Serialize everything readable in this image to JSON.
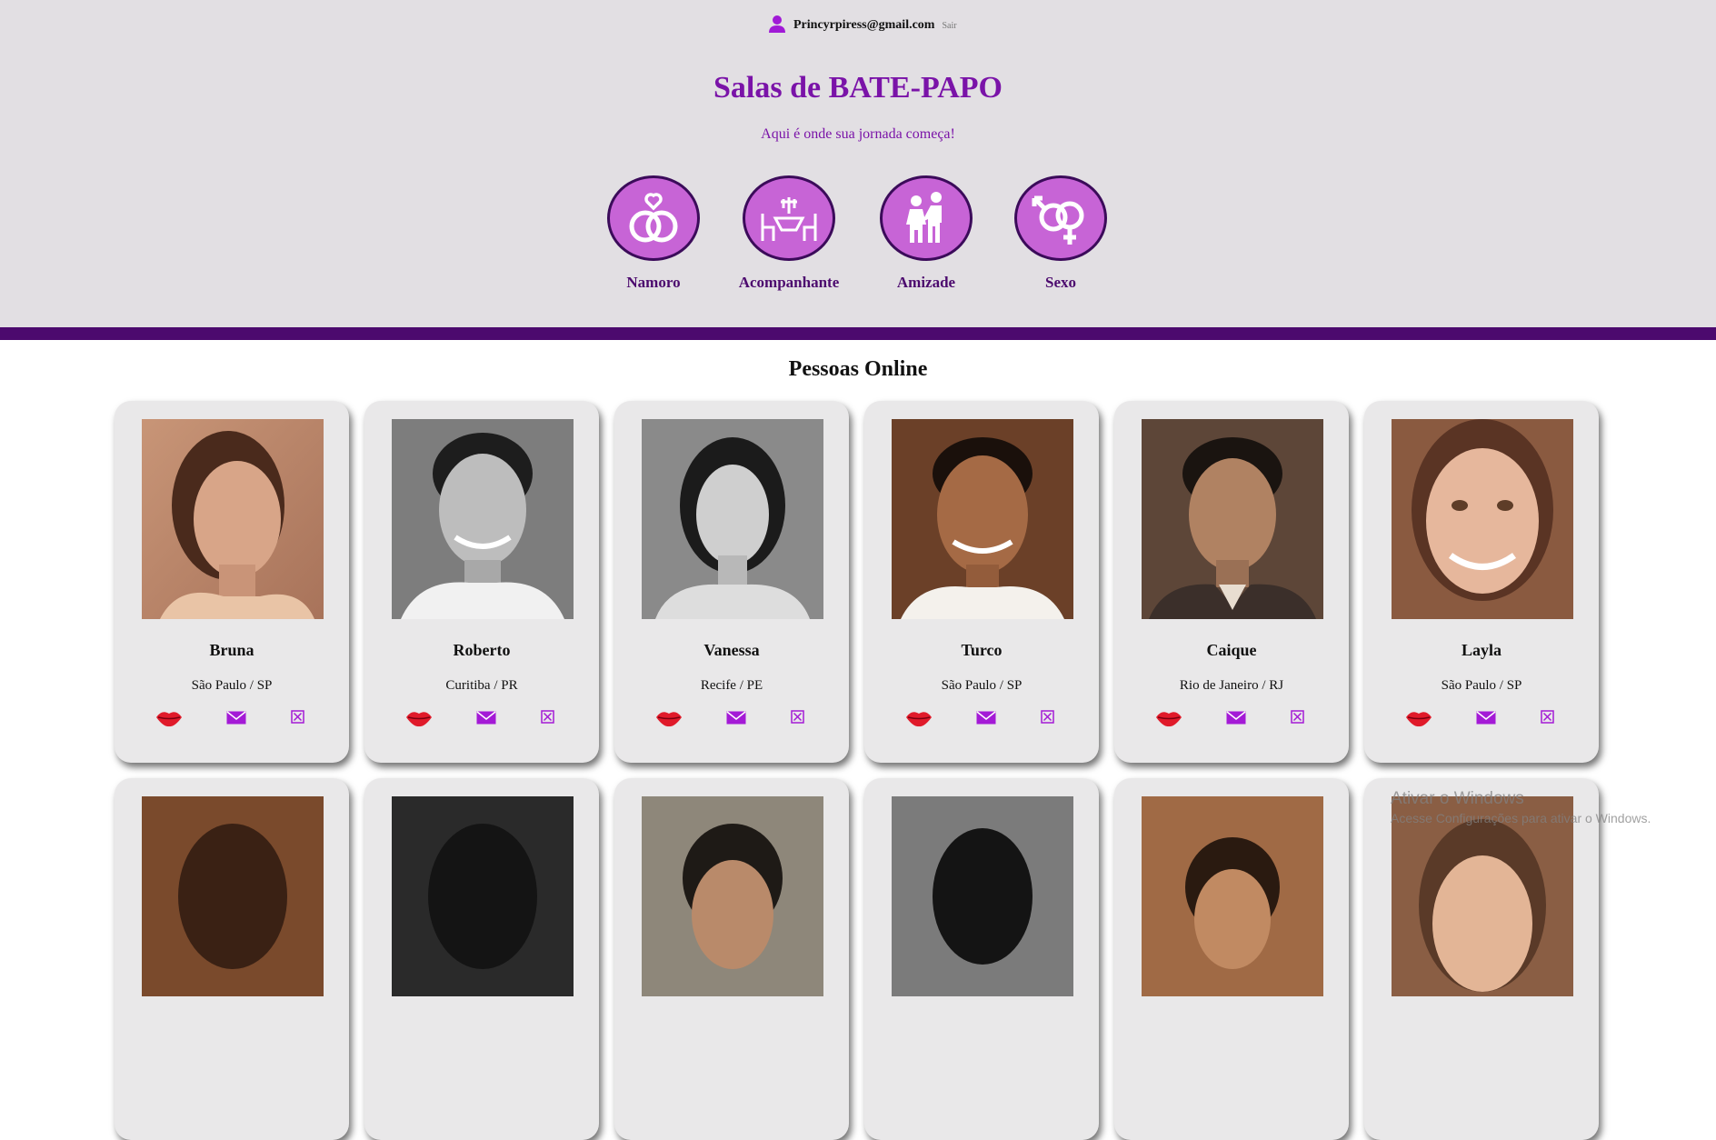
{
  "user": {
    "email": "Princyrpiress@gmail.com",
    "logout_label": "Sair"
  },
  "header": {
    "title": "Salas de BATE-PAPO",
    "subtitle": "Aqui é onde sua jornada começa!"
  },
  "rooms": [
    {
      "label": "Namoro",
      "icon": "rings-heart-icon"
    },
    {
      "label": "Acompanhante",
      "icon": "dinner-table-icon"
    },
    {
      "label": "Amizade",
      "icon": "handshake-people-icon"
    },
    {
      "label": "Sexo",
      "icon": "gender-symbols-icon"
    }
  ],
  "online": {
    "title": "Pessoas Online",
    "profiles": [
      {
        "name": "Bruna",
        "city": "São Paulo / SP"
      },
      {
        "name": "Roberto",
        "city": "Curitiba / PR"
      },
      {
        "name": "Vanessa",
        "city": "Recife / PE"
      },
      {
        "name": "Turco",
        "city": "São Paulo / SP"
      },
      {
        "name": "Caique",
        "city": "Rio de Janeiro / RJ"
      },
      {
        "name": "Layla",
        "city": "São Paulo / SP"
      }
    ]
  },
  "actions": {
    "kiss_icon": "lips-icon",
    "mail_icon": "envelope-icon",
    "block_icon": "close-box-icon"
  },
  "watermark": {
    "line1": "Ativar o Windows",
    "line2": "Acesse Configurações para ativar o Windows."
  },
  "colors": {
    "accent": "#7a13a8",
    "dark_purple": "#4c0a6e",
    "icon_fill": "#c764d6",
    "header_bg": "#e2dfe3",
    "card_bg": "#e9e8e9",
    "kiss": "#e01a2a"
  }
}
